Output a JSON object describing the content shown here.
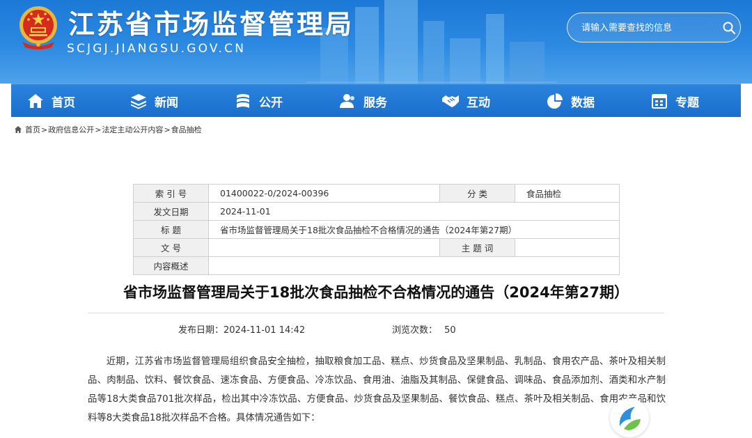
{
  "header": {
    "site_title": "江苏省市场监督管理局",
    "site_domain": "SCJGJ.JIANGSU.GOV.CN",
    "search_placeholder": "请输入需要查找的信息",
    "colors": {
      "header_blue": "#1c78d6",
      "nav_blue": "#1a6fcd"
    }
  },
  "nav": {
    "items": [
      {
        "label": "首页",
        "icon": "home-icon"
      },
      {
        "label": "新闻",
        "icon": "layers-icon"
      },
      {
        "label": "公开",
        "icon": "document-stack-icon"
      },
      {
        "label": "服务",
        "icon": "people-icon"
      },
      {
        "label": "互动",
        "icon": "handshake-icon"
      },
      {
        "label": "数据",
        "icon": "pie-chart-icon"
      },
      {
        "label": "专题",
        "icon": "calendar-icon"
      }
    ]
  },
  "breadcrumb": [
    "首页",
    "政府信息公开",
    "法定主动公开内容",
    "食品抽检"
  ],
  "meta": {
    "index_label": "索 引 号",
    "index_value": "01400022-0/2024-00396",
    "category_label": "分 类",
    "category_value": "食品抽检",
    "date_label": "发文日期",
    "date_value": "2024-11-01",
    "title_label": "标 题",
    "title_value": "省市场监督管理局关于18批次食品抽检不合格情况的通告（2024年第27期）",
    "doc_no_label": "文 号",
    "doc_no_value": "",
    "subject_label": "主 题 词",
    "subject_value": "",
    "summary_label": "内容概述",
    "summary_value": ""
  },
  "article": {
    "title": "省市场监督管理局关于18批次食品抽检不合格情况的通告（2024年第27期）",
    "publish_label": "发布日期：",
    "publish_value": "2024-11-01 14:42",
    "views_label": "浏览次数：",
    "views_value": "50",
    "body": "近期，江苏省市场监督管理局组织食品安全抽检，抽取粮食加工品、糕点、炒货食品及坚果制品、乳制品、食用农产品、茶叶及相关制品、肉制品、饮料、餐饮食品、速冻食品、方便食品、冷冻饮品、食用油、油脂及其制品、保健食品、调味品、食品添加剂、酒类和水产制品等18大类食品701批次样品，检出其中冷冻饮品、方便食品、炒货食品及坚果制品、餐饮食品、糕点、茶叶及相关制品、食用农产品和饮料等8大类食品18批次样品不合格。具体情况通告如下："
  }
}
